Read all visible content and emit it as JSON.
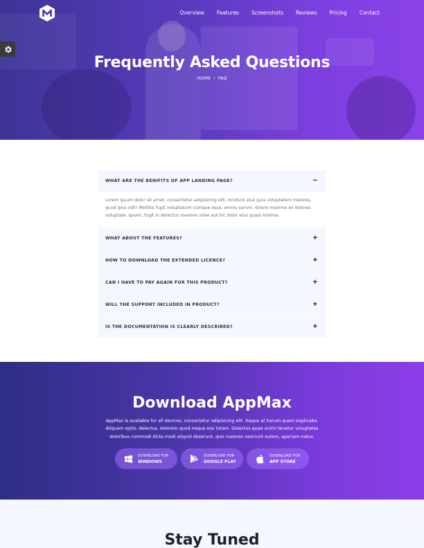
{
  "nav": {
    "items": [
      "Overview",
      "Features",
      "Screenshots",
      "Reviews",
      "Pricing",
      "Contact"
    ]
  },
  "hero": {
    "title": "Frequently Asked Questions",
    "breadcrumb_home": "HOME",
    "breadcrumb_sep": "›",
    "breadcrumb_current": "FAQ"
  },
  "faq": {
    "items": [
      {
        "question": "WHAT ARE THE BENIFITS OF APP LANDING PAGE?",
        "toggle": "−",
        "expanded": true,
        "answer": "Lorem ipsum dolor sit amet, consectetur adipisicing elit. Incidunt eius quia voluptatem maiores, quod ipsa odit! Mollitia fugit voluptatum cumque esse, omnis earum, dolore maxime ex dolores voluptate. Ipsam, fugit in delectus maxime vitae aut hic dolor eius quasi minima."
      },
      {
        "question": "WHAT ABOUT THE FEATURES?",
        "toggle": "+"
      },
      {
        "question": "HOW TO DOWNLOAD THE EXTENDED LICENCE?",
        "toggle": "+"
      },
      {
        "question": "CAN I HAVE TO PAY AGAIN FOR THIS PRODUCT?",
        "toggle": "+"
      },
      {
        "question": "WILL THE SUPPORT INCLUDED IN PRODUCT?",
        "toggle": "+"
      },
      {
        "question": "IS THE DOCUMENTATION IS CLEARLY DESCRIBED?",
        "toggle": "+"
      }
    ]
  },
  "download": {
    "title": "Download AppMax",
    "text": "AppMax is available for all devices, consectetur adipisicing elit. Itaque at harum quam explicabo. Aliquam optio, delectus, dolorem quod neque eos totam. Delectus quae animi tenetur voluptates doloribus commodi dicta modi aliquid deserunt, quis maiores nesciunt autem, aperiam natus.",
    "buttons": [
      {
        "line1": "DOWNLOAD FOR",
        "line2": "WINDOWS",
        "icon": "windows-icon"
      },
      {
        "line1": "DOWNLOAD FOR",
        "line2": "GOOGLE PLAY",
        "icon": "google-play-icon"
      },
      {
        "line1": "DOWNLOAD FOR",
        "line2": "APP STORE",
        "icon": "apple-icon"
      }
    ]
  },
  "stay_tuned": {
    "title": "Stay Tuned"
  },
  "colors": {
    "accent": "#7d3fe0",
    "hero_dark": "#3c3496",
    "faq_bg": "#f4f7fd"
  }
}
